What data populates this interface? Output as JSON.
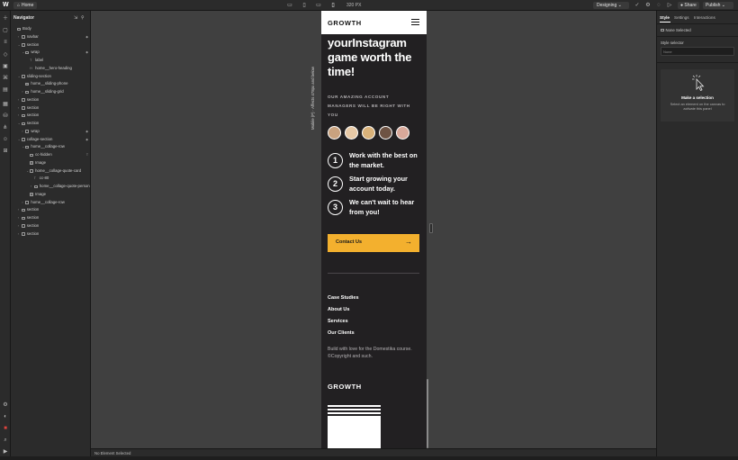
{
  "topbar": {
    "logo": "W",
    "page_name": "Home",
    "page_icon": "house-icon",
    "width_label": "320 PX",
    "mode_label": "Designing",
    "share_label": "Share",
    "publish_label": "Publish"
  },
  "navigator": {
    "title": "Navigator",
    "rows": [
      {
        "label": "Body"
      },
      {
        "label": "navbar"
      },
      {
        "label": "section"
      },
      {
        "label": "wrap"
      },
      {
        "label": "label"
      },
      {
        "label": "home__hero-heading"
      },
      {
        "label": "sliding-section"
      },
      {
        "label": "home__sliding-phone"
      },
      {
        "label": "home__sliding-grid"
      },
      {
        "label": "section"
      },
      {
        "label": "section"
      },
      {
        "label": "section"
      },
      {
        "label": "section"
      },
      {
        "label": "wrap"
      },
      {
        "label": "collage-section"
      },
      {
        "label": "home__collage-row"
      },
      {
        "label": "cc-hidden"
      },
      {
        "label": "Image"
      },
      {
        "label": "home__collage-quote-card"
      },
      {
        "label": "cc-80"
      },
      {
        "label": "home__collage-quote-person"
      },
      {
        "label": "Image"
      },
      {
        "label": "home__collage-row"
      },
      {
        "label": "section"
      },
      {
        "label": "section"
      },
      {
        "label": "section"
      },
      {
        "label": "section"
      }
    ]
  },
  "canvas": {
    "breakpoint_label": "Mobile (P) · Affects 478px and below",
    "status": "No Element Selected"
  },
  "site": {
    "brand": "GROWTH",
    "hero_heading": "yourInstagram game worth the time!",
    "managers_text": "OUR AMAZING ACCOUNT MANAGERS WILL BE RIGHT WITH YOU",
    "steps": [
      {
        "num": "1",
        "text": "Work with the best on the market."
      },
      {
        "num": "2",
        "text": "Start growing your account today."
      },
      {
        "num": "3",
        "text": "We can't wait to hear from you!"
      }
    ],
    "contact_label": "Contact Us",
    "contact_arrow": "→",
    "footer_links": [
      "Case Studies",
      "About Us",
      "Services",
      "Our Clients"
    ],
    "footer_copy": "Build with love for the Domestika course. ©Copyright and such.",
    "footer_brand": "GROWTH"
  },
  "rightpanel": {
    "tabs": [
      "Style",
      "Settings",
      "Interactions"
    ],
    "none_selected": "None Selected",
    "style_selector_label": "Style selector",
    "style_selector_placeholder": "None",
    "make_selection": "Make a selection",
    "make_selection_desc": "Select an element on the canvas to activate this panel"
  },
  "colors": {
    "accent": "#f3b02e",
    "site_bg": "#222022",
    "canvas_bg": "#404040",
    "panel_bg": "#2b2b2b"
  }
}
